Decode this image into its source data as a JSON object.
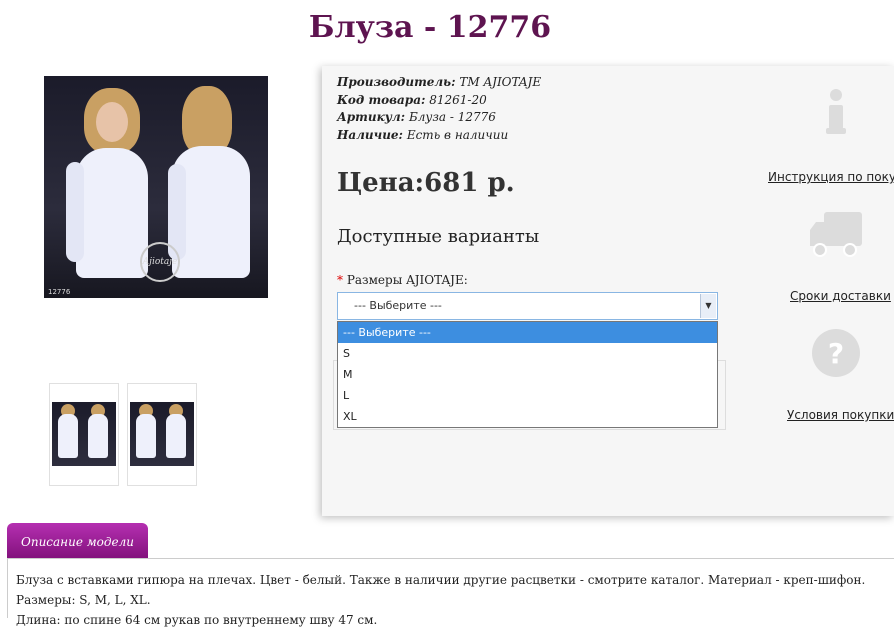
{
  "product": {
    "title": "Блуза - 12776",
    "manufacturer_label": "Производитель:",
    "manufacturer_value": "ТМ AJIOTAJE",
    "code_label": "Код товара:",
    "code_value": "81261-20",
    "article_label": "Артикул:",
    "article_value": "Блуза - 12776",
    "availability_label": "Наличие:",
    "availability_value": "Есть в наличии",
    "price": "Цена:681 р.",
    "image_watermark": "Ajiotaje",
    "image_code": "12776"
  },
  "variants": {
    "heading": "Доступные варианты",
    "required_mark": "*",
    "size_label": "Размеры AJIOTAJE:",
    "selected": "--- Выберите ---",
    "options": [
      "--- Выберите ---",
      "S",
      "M",
      "L",
      "XL"
    ]
  },
  "sidebar": {
    "instruction_link": "Инструкция по покупке",
    "delivery_link": "Сроки доставки",
    "conditions_link": "Условия покупки",
    "info_icon": "info-icon",
    "truck_icon": "truck-icon",
    "question_icon": "question-icon"
  },
  "description": {
    "tab_label": "Описание модели",
    "line1": "Блуза с вставками гипюра на плечах. Цвет - белый. Также в наличии другие расцветки - смотрите каталог. Материал - креп-шифон. Размеры: S, M, L, XL.",
    "line2": "Длина: по спине 64 см рукав по внутреннему шву 47 см."
  },
  "colors": {
    "title": "#5e1450",
    "tab": "#a0209b",
    "selected_option": "#3d8ee0"
  }
}
